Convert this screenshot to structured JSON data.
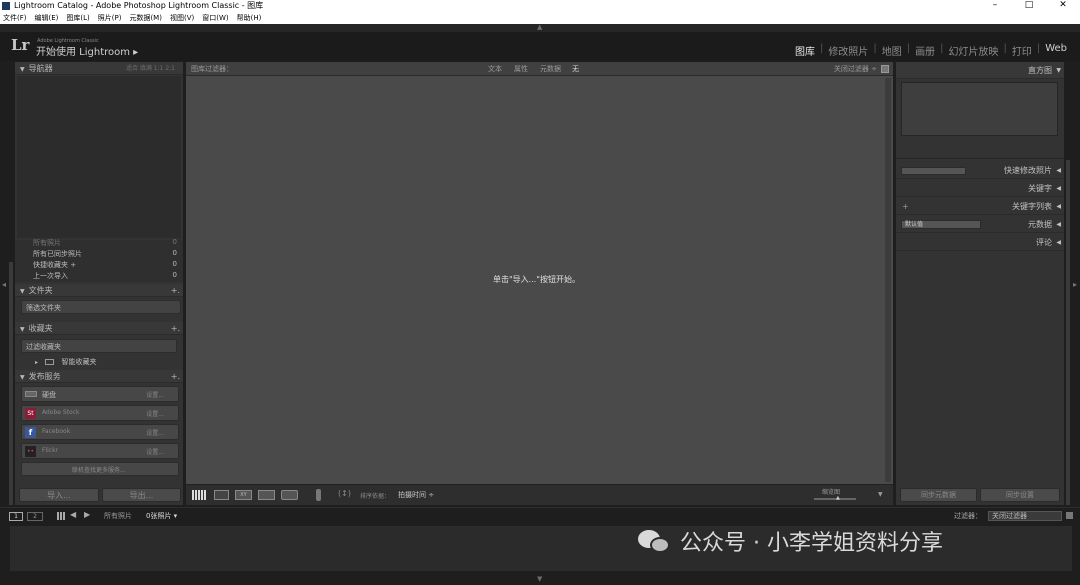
{
  "window": {
    "title": "Lightroom Catalog - Adobe Photoshop Lightroom Classic - 图库",
    "minimize": "–",
    "maximize": "□",
    "close": "✕"
  },
  "menu": [
    "文件(F)",
    "编辑(E)",
    "图库(L)",
    "照片(P)",
    "元数据(M)",
    "视图(V)",
    "窗口(W)",
    "帮助(H)"
  ],
  "identity": {
    "logo": "Lr",
    "small": "Adobe Lightroom Classic",
    "big": "开始使用 Lightroom ▸"
  },
  "modules": [
    "图库",
    "修改照片",
    "地图",
    "画册",
    "幻灯片放映",
    "打印",
    "Web"
  ],
  "left": {
    "navigator": {
      "label": "导航器",
      "options": "适合  填满  1:1  2:1"
    },
    "catalog_rows": [
      {
        "label": "所有照片",
        "count": "0"
      },
      {
        "label": "所有已同步照片",
        "count": "0"
      },
      {
        "label": "快捷收藏夹 +",
        "count": "0"
      },
      {
        "label": "上一次导入",
        "count": "0"
      }
    ],
    "folders": {
      "label": "文件夹",
      "plus": "+.",
      "filter": "筛选文件夹"
    },
    "collections": {
      "label": "收藏夹",
      "plus": "+.",
      "filter": "过滤收藏夹",
      "smart": "智能收藏夹"
    },
    "publish": {
      "label": "发布服务",
      "plus": "+.",
      "services": [
        {
          "name": "硬盘",
          "action": "设置...",
          "color": "#5a5a5a",
          "badge": ""
        },
        {
          "name": "Adobe Stock",
          "action": "设置...",
          "color": "#8a1c3a",
          "badge": "St"
        },
        {
          "name": "Facebook",
          "action": "设置...",
          "color": "#3b5998",
          "badge": "f"
        },
        {
          "name": "Flickr",
          "action": "设置...",
          "color": "#222222",
          "badge": "••"
        }
      ],
      "find_more": "联机查找更多服务..."
    },
    "import_btn": "导入...",
    "export_btn": "导出..."
  },
  "filterbar": {
    "title": "图库过滤器：",
    "options": [
      "文本",
      "属性",
      "元数据",
      "无"
    ],
    "preset": "关闭过滤器 ÷"
  },
  "center_message": "单击\"导入...\"按钮开始。",
  "toolbar": {
    "sort_label": "排序依据：",
    "sort_value": "拍摄时间 ÷",
    "thumb_label": "缩览图"
  },
  "right": {
    "histogram": "直方图",
    "quick_develop": "快速修改照片",
    "keywording": "关键字",
    "keyword_list": "关键字列表",
    "metadata": "元数据",
    "metadata_preset": "默认值",
    "comments": "评论",
    "sync_meta": "同步元数据",
    "sync_settings": "同步设置"
  },
  "filmstrip": {
    "source": "所有照片",
    "count": "0张照片 ▾",
    "filter_label": "过滤器：",
    "filter_value": "关闭过滤器"
  },
  "watermark": "公众号 · 小李学姐资料分享"
}
